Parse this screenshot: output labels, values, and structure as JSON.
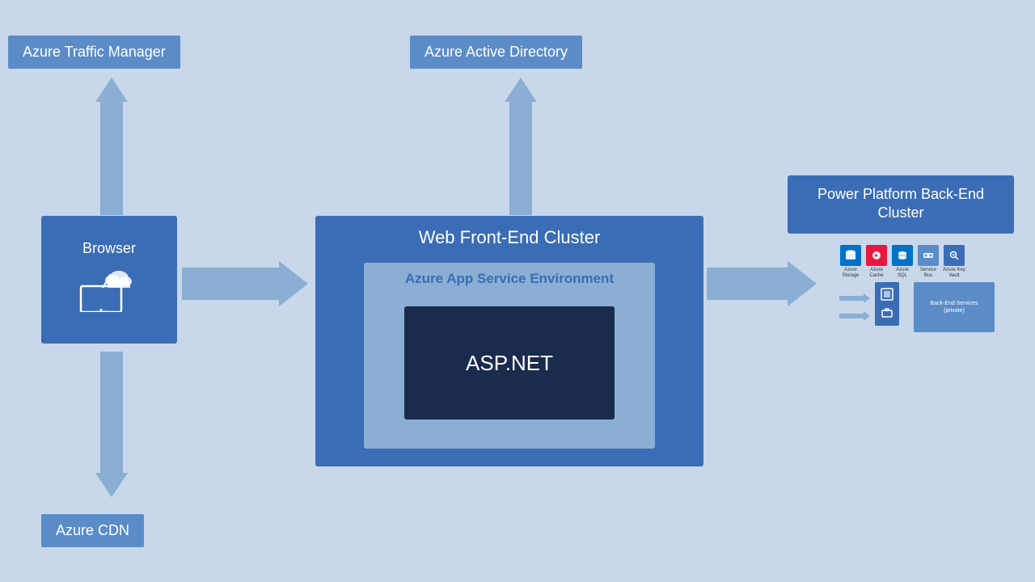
{
  "labels": {
    "traffic_manager": "Azure Traffic Manager",
    "active_directory": "Azure Active Directory",
    "browser": "Browser",
    "web_cluster": "Web Front-End Cluster",
    "app_service": "Azure App Service Environment",
    "aspnet": "ASP.NET",
    "power_platform": "Power Platform Back-End Cluster",
    "cdn": "Azure CDN"
  },
  "mini_icons": [
    {
      "label": "Azure Storage",
      "char": "🗄"
    },
    {
      "label": "Azure Cache",
      "char": "⚡"
    },
    {
      "label": "Azure SQL",
      "char": "🗃"
    },
    {
      "label": "Service Bus",
      "char": "📨"
    },
    {
      "label": "Azure Key Vault",
      "char": "🔑"
    }
  ],
  "colors": {
    "bg": "#c8d8ea",
    "dark_blue": "#3a6db5",
    "medium_blue": "#5b8cc8",
    "light_blue": "#8aaed4",
    "very_dark": "#1a2c4e",
    "white": "#ffffff"
  }
}
